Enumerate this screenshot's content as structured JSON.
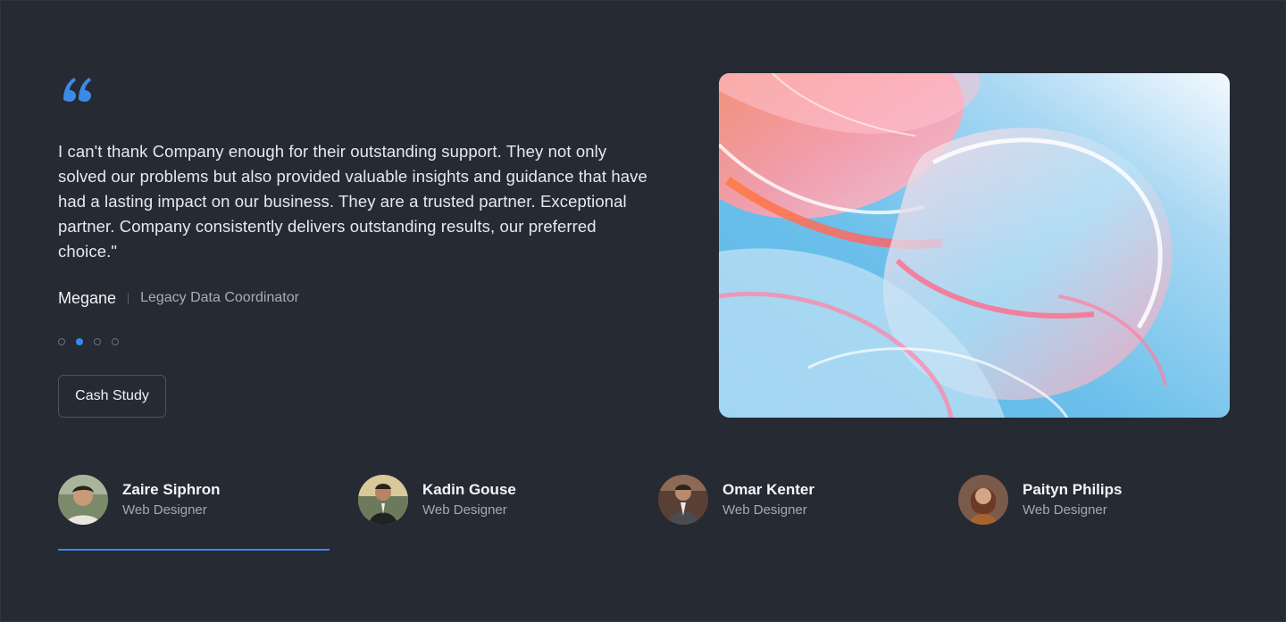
{
  "testimonial": {
    "quote_mark": "“",
    "text": "I can't thank Company enough for their outstanding support. They not only solved our problems but also provided valuable insights and guidance that have had a lasting impact on our business. They are a trusted partner. Exceptional partner. Company consistently delivers outstanding results, our preferred choice.\"",
    "author_name": "Megane",
    "author_role": "Legacy Data Coordinator"
  },
  "pagination": {
    "count": 4,
    "active_index": 1
  },
  "cta": {
    "label": "Cash Study"
  },
  "people": [
    {
      "name": "Zaire Siphron",
      "role": "Web Designer",
      "active": true
    },
    {
      "name": "Kadin Gouse",
      "role": "Web Designer",
      "active": false
    },
    {
      "name": "Omar Kenter",
      "role": "Web Designer",
      "active": false
    },
    {
      "name": "Paityn Philips",
      "role": "Web Designer",
      "active": false
    }
  ],
  "colors": {
    "background": "#252a33",
    "accent": "#3b8ae8",
    "text_primary": "#e7e9ee",
    "text_secondary": "#a7adb7"
  },
  "icons": {
    "quote": "quote-icon"
  }
}
